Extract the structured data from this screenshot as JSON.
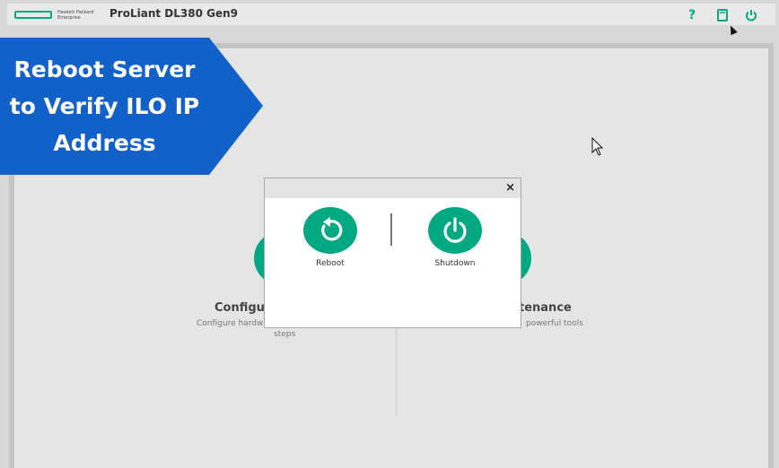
{
  "header": {
    "logo_text": "Hewlett Packard Enterprise",
    "product_title": "ProLiant DL380 Gen9",
    "icons": [
      "help-icon",
      "document-icon",
      "power-icon"
    ],
    "help_glyph": "?",
    "brand_color": "#01a982"
  },
  "banner": {
    "text": "Reboot Server to Verify ILO IP Address",
    "line1": "Reboot Server",
    "line2": "to Verify ILO IP",
    "line3": "Address",
    "color": "#1261c8"
  },
  "background_panels": {
    "left_title": "Configu",
    "left_subtitle": "Configure hardw",
    "left_subtitle_2": "steps",
    "right_title": "tenance",
    "right_subtitle": "powerful tools"
  },
  "dialog": {
    "close_label": "×",
    "actions": [
      {
        "label": "Reboot",
        "icon": "reboot-icon"
      },
      {
        "label": "Shutdown",
        "icon": "power-icon"
      }
    ]
  }
}
